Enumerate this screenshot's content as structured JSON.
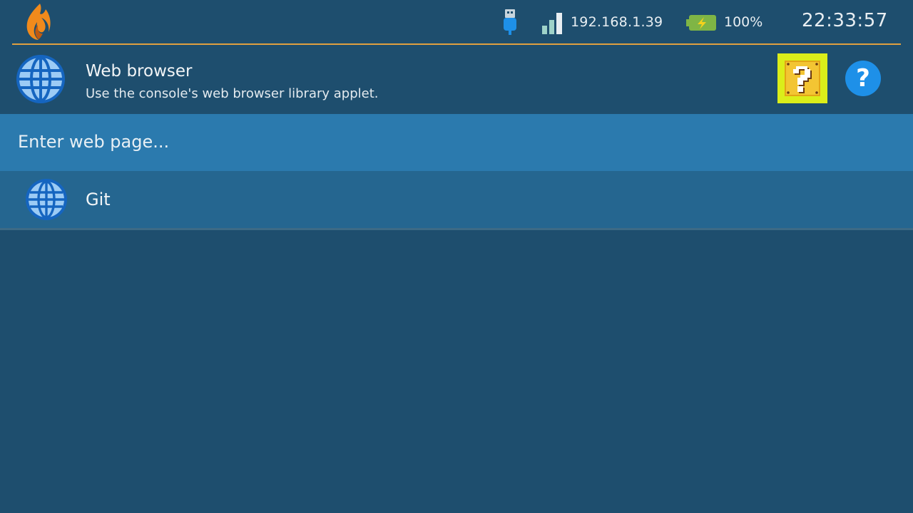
{
  "status_bar": {
    "ip_address": "192.168.1.39",
    "battery_level": "100%",
    "time": "22:33:57",
    "icons": [
      "flame-logo-icon",
      "usb-icon",
      "signal-icon",
      "battery-icon"
    ]
  },
  "header": {
    "title": "Web browser",
    "subtitle": "Use the console's web browser library applet.",
    "help_glyph": "?",
    "icons": [
      "globe-icon",
      "question-block-icon",
      "help-icon"
    ]
  },
  "url_input": {
    "placeholder": "Enter web page..."
  },
  "bookmarks": [
    {
      "label": "Git",
      "icon": "globe-icon"
    }
  ],
  "colors": {
    "background": "#1e4e6e",
    "accent_line": "#e0a040",
    "url_row": "#2b7aae",
    "list_row": "#256690",
    "highlight": "#dbee1a",
    "help_button": "#1e90e8"
  }
}
